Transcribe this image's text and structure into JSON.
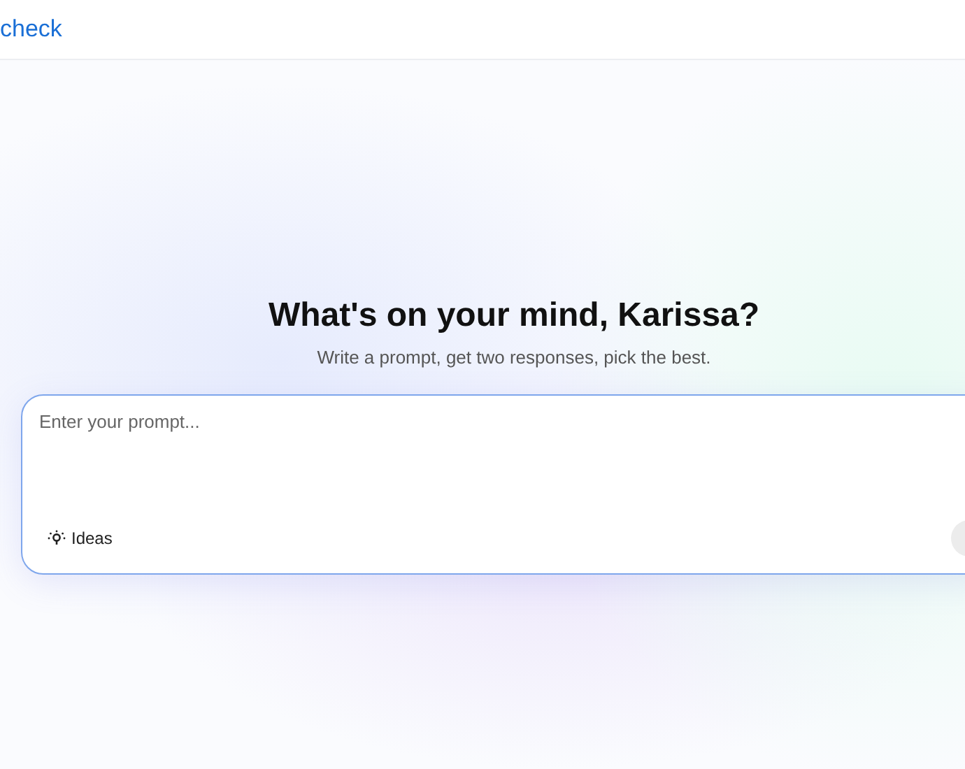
{
  "header": {
    "logo": "check"
  },
  "hero": {
    "title": "What's on your mind, Karissa?",
    "subtitle": "Write a prompt, get two responses, pick the best."
  },
  "prompt": {
    "placeholder": "Enter your prompt...",
    "ideas_button": "Ideas"
  }
}
